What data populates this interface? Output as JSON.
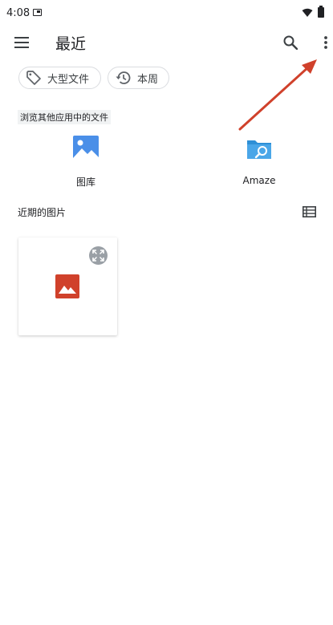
{
  "status_bar": {
    "time": "4:08",
    "icons": [
      "notification-icon",
      "wifi-icon",
      "battery-icon"
    ]
  },
  "toolbar": {
    "menu_icon": "hamburger-menu-icon",
    "title": "最近",
    "search_icon": "search-icon",
    "more_icon": "more-vert-icon"
  },
  "chips": [
    {
      "label": "大型文件",
      "icon": "tag-icon"
    },
    {
      "label": "本周",
      "icon": "history-icon"
    }
  ],
  "apps_section": {
    "label": "浏览其他应用中的文件",
    "apps": [
      {
        "label": "图库",
        "icon": "gallery-image-icon"
      },
      {
        "label": "Amaze",
        "icon": "amaze-folder-search-icon"
      }
    ]
  },
  "recent_section": {
    "label": "近期的图片",
    "view_toggle_icon": "list-view-icon",
    "items": [
      {
        "type": "image",
        "icon": "image-placeholder-icon",
        "action_icon": "expand-icon"
      }
    ]
  },
  "colors": {
    "accent_red": "#d0412b",
    "gallery_blue": "#4a8fe8",
    "amaze_blue": "#2e8fd6",
    "chip_border": "#dadce0",
    "icon_gray": "#5f6368"
  },
  "annotation": {
    "type": "arrow",
    "color": "#d0412b",
    "points_to": "more-vert-icon"
  }
}
